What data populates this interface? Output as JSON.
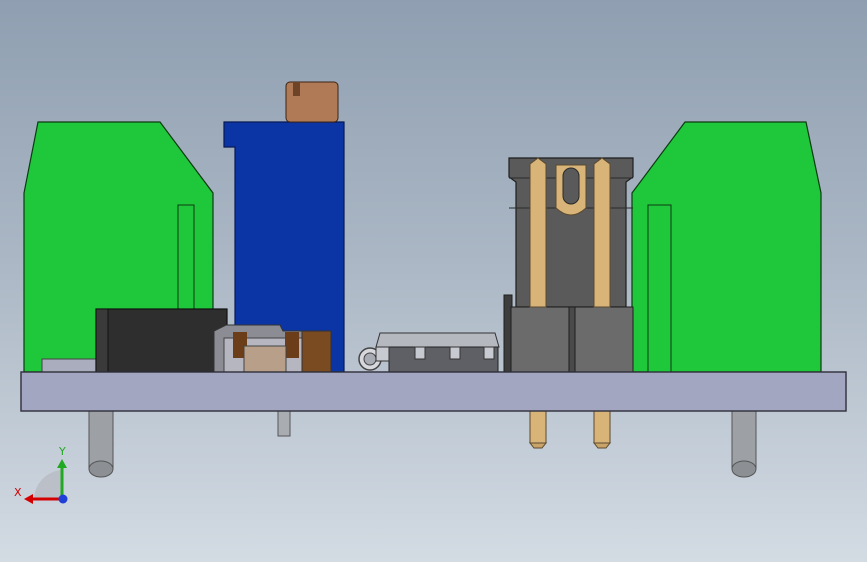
{
  "viewport": {
    "background_top": "#8f9fb1",
    "background_bottom": "#d3dbe3"
  },
  "model": {
    "board_color": "#a3a6c0",
    "terminal_block_color": "#1fc83a",
    "potentiometer_color": "#0b35a5",
    "potentiometer_knob_color": "#b07a56",
    "header_body_color": "#5a5a5a",
    "header_pin_color": "#d9b478",
    "jack_color": "#2e2e2e",
    "standoff_color": "#9da1a6"
  },
  "triad": {
    "x_label": "X",
    "y_label": "Y",
    "x_color": "#d40000",
    "y_color": "#22a822",
    "z_color": "#1f3fd6"
  }
}
